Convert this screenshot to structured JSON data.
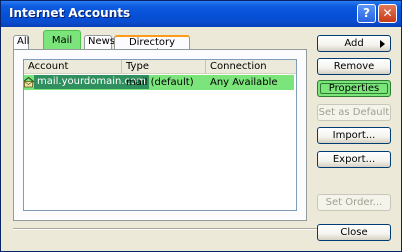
{
  "window": {
    "title": "Internet Accounts",
    "help_label": "?",
    "close_glyph": "✕"
  },
  "tabs": [
    {
      "label": "All"
    },
    {
      "label": "Mail",
      "selected": true
    },
    {
      "label": "News"
    },
    {
      "label": "Directory Service"
    }
  ],
  "list": {
    "columns": [
      "Account",
      "Type",
      "Connection"
    ],
    "rows": [
      {
        "account": "mail.yourdomain.com",
        "type": "mail (default)",
        "connection": "Any Available",
        "icon": "mail-account-icon",
        "selected": true
      }
    ]
  },
  "buttons": {
    "add": "Add",
    "remove": "Remove",
    "properties": "Properties",
    "set_default": "Set as Default",
    "import": "Import...",
    "export": "Export...",
    "set_order": "Set Order...",
    "close": "Close"
  },
  "colors": {
    "highlight": "#7be47b",
    "titlebar": "#0a4dd0",
    "selected_cell": "#2f8f5f"
  }
}
